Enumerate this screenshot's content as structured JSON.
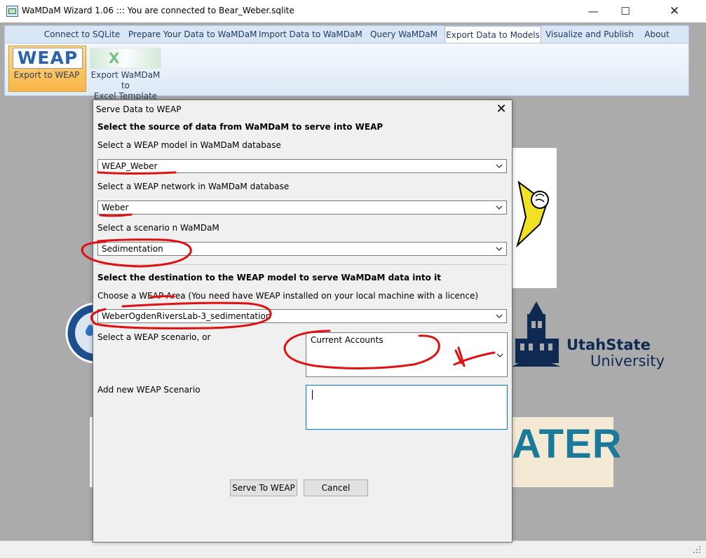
{
  "window": {
    "title": "WaMDaM Wizard 1.06 ::: You are connected to Bear_Weber.sqlite",
    "minimize_glyph": "—",
    "maximize_glyph": "☐",
    "close_glyph": "✕"
  },
  "ribbon": {
    "tabs": [
      {
        "label": "Connect to SQLite"
      },
      {
        "label": "Prepare Your Data to WaMDaM"
      },
      {
        "label": "Import Data to WaMDaM"
      },
      {
        "label": "Query WaMDaM"
      },
      {
        "label": "Export Data to Models",
        "active": true
      },
      {
        "label": "Visualize and Publish"
      },
      {
        "label": "About"
      }
    ],
    "buttons": {
      "export_weap_logo": "WEAP",
      "export_weap": "Export to WEAP",
      "export_excel_logo": "X",
      "export_excel_line1": "Export WaMDaM to",
      "export_excel_line2": "Excel Template"
    }
  },
  "background": {
    "usu_line1": "UtahState",
    "usu_line2": "University",
    "water_text": "ATER"
  },
  "dialog": {
    "title": "Serve Data to WEAP",
    "close_glyph": "✕",
    "source_header": "Select the source of data from WaMDaM to serve into WEAP",
    "model_label": "Select a WEAP model in WaMDaM database",
    "model_value": "WEAP_Weber",
    "network_label": "Select a WEAP network in WaMDaM database",
    "network_value": "Weber",
    "scenario_label": "Select a scenario n WaMDaM",
    "scenario_value": "Sedimentation",
    "dest_header": "Select the destination to the WEAP model to serve WaMDaM data into it",
    "area_label": "Choose a WEAP Area (You need  have WEAP installed on your local machine with a licence)",
    "area_value": "WeberOgdenRiversLab-3_sedimentation",
    "weap_scenario_label": "Select a WEAP scenario, or",
    "weap_scenario_value": "Current Accounts",
    "new_scenario_label": "Add new WEAP Scenario",
    "new_scenario_value": "",
    "serve_button": "Serve To WEAP",
    "cancel_button": "Cancel"
  },
  "colors": {
    "ribbon_tab_bg": "#d9e6f5",
    "active_button": "#f7b548",
    "annotation_red": "#e11010",
    "focus_border": "#0078d7"
  }
}
